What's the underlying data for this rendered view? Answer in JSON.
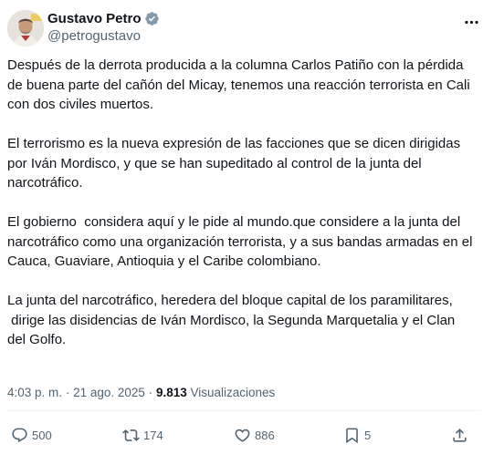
{
  "author": {
    "display_name": "Gustavo Petro",
    "handle": "@petrogustavo",
    "verified": true
  },
  "tweet": {
    "paragraphs": [
      "Después de la derrota producida a la columna Carlos Patiño con la pérdida de buena parte del cañón del Micay, tenemos una reacción terrorista en Cali con dos civiles muertos.",
      "El terrorismo es la nueva expresión de las facciones que se dicen dirigidas por Iván Mordisco, y que se han supeditado al control de la junta del narcotráfico.",
      "El gobierno  considera aquí y le pide al mundo.que considere a la junta del narcotráfico como una organización terrorista, y a sus bandas armadas en el Cauca, Guaviare, Antioquia y el Caribe colombiano.",
      "La junta del narcotráfico, heredera del bloque capital de los paramilitares,\n dirige las disidencias de Iván Mordisco, la Segunda Marquetalia y el Clan del Golfo."
    ],
    "time": "4:03 p. m.",
    "separator": "·",
    "date": "21 ago. 2025",
    "views_count": "9.813",
    "views_label": "Visualizaciones"
  },
  "actions": {
    "replies": "500",
    "reposts": "174",
    "likes": "886",
    "bookmarks": "5"
  },
  "icons": {
    "verified": "verified-badge-icon",
    "more": "more-options-icon",
    "reply": "reply-icon",
    "repost": "repost-icon",
    "like": "heart-icon",
    "bookmark": "bookmark-icon",
    "share": "share-icon"
  },
  "colors": {
    "text_primary": "#0f1419",
    "text_secondary": "#536471",
    "verified_blue": "#829aab",
    "divider": "#eff3f4"
  }
}
